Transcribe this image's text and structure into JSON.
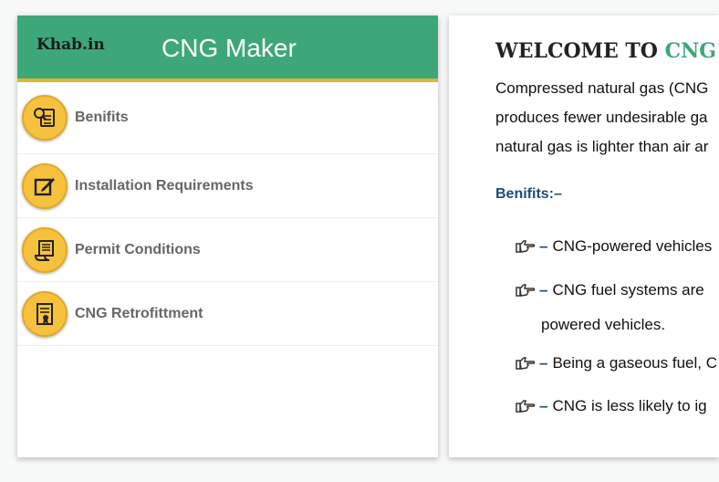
{
  "sidebar": {
    "logo": "Khab.in",
    "title": "CNG Maker",
    "items": [
      {
        "label": "Benifits",
        "icon": "magnifier-document-icon"
      },
      {
        "label": "Installation Requirements",
        "icon": "edit-document-icon"
      },
      {
        "label": "Permit Conditions",
        "icon": "scroll-document-icon"
      },
      {
        "label": "CNG Retrofittment",
        "icon": "certificate-document-icon"
      }
    ]
  },
  "main": {
    "welcome_prefix": "WELCOME TO",
    "welcome_accent": "CNG V",
    "intro_lines": [
      "Compressed natural gas (CNG",
      "produces fewer undesirable ga",
      "natural gas is lighter than air ar"
    ],
    "section_title": "Benifits:–",
    "dash": "–",
    "benefits": [
      "CNG-powered vehicles",
      "CNG fuel systems are",
      "Being a gaseous fuel, C",
      "CNG is less likely to ig"
    ],
    "benefit_continuation": "powered vehicles."
  },
  "colors": {
    "header": "#3ea77a",
    "header_border": "#e0b431",
    "icon_bg": "#f6c23e",
    "section_title": "#1a4d7a"
  }
}
